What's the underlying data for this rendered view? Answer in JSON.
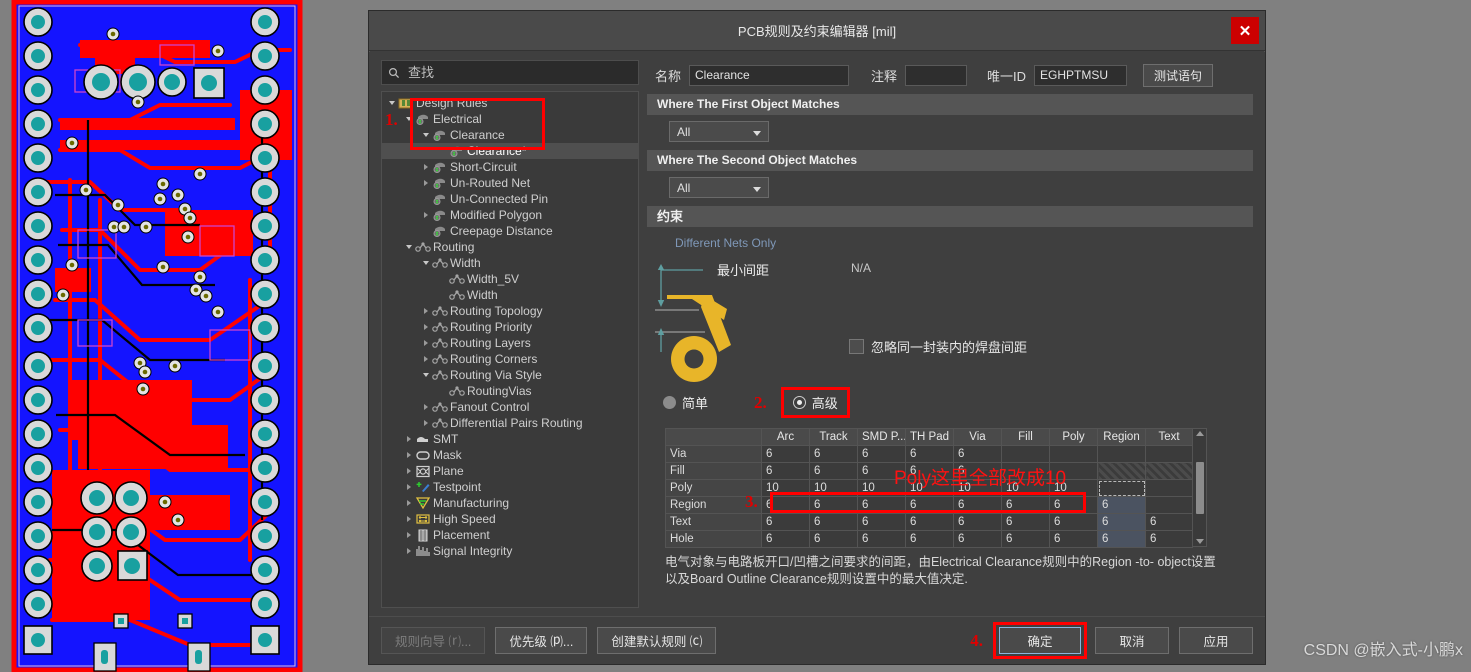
{
  "window": {
    "title": "PCB规则及约束编辑器 [mil]",
    "close_label": "✕"
  },
  "search": {
    "placeholder": "查找",
    "value": "",
    "icon": "search-icon"
  },
  "tree": {
    "items": [
      {
        "label": "Design Rules",
        "depth": 0,
        "arrow": "down",
        "icon": "folder-rules-icon",
        "selected": false
      },
      {
        "label": "Electrical",
        "depth": 1,
        "arrow": "down",
        "icon": "electrical-icon",
        "selected": false
      },
      {
        "label": "Clearance",
        "depth": 2,
        "arrow": "down",
        "icon": "electrical-icon",
        "selected": false
      },
      {
        "label": "Clearance*",
        "depth": 3,
        "arrow": "none",
        "icon": "electrical-icon",
        "selected": true
      },
      {
        "label": "Short-Circuit",
        "depth": 2,
        "arrow": "right",
        "icon": "electrical-icon",
        "selected": false
      },
      {
        "label": "Un-Routed Net",
        "depth": 2,
        "arrow": "right",
        "icon": "electrical-icon",
        "selected": false
      },
      {
        "label": "Un-Connected Pin",
        "depth": 2,
        "arrow": "none",
        "icon": "electrical-icon",
        "selected": false
      },
      {
        "label": "Modified Polygon",
        "depth": 2,
        "arrow": "right",
        "icon": "electrical-icon",
        "selected": false
      },
      {
        "label": "Creepage Distance",
        "depth": 2,
        "arrow": "none",
        "icon": "electrical-icon",
        "selected": false
      },
      {
        "label": "Routing",
        "depth": 1,
        "arrow": "down",
        "icon": "routing-icon",
        "selected": false
      },
      {
        "label": "Width",
        "depth": 2,
        "arrow": "down",
        "icon": "routing-icon",
        "selected": false
      },
      {
        "label": "Width_5V",
        "depth": 3,
        "arrow": "none",
        "icon": "routing-icon",
        "selected": false
      },
      {
        "label": "Width",
        "depth": 3,
        "arrow": "none",
        "icon": "routing-icon",
        "selected": false
      },
      {
        "label": "Routing Topology",
        "depth": 2,
        "arrow": "right",
        "icon": "routing-icon",
        "selected": false
      },
      {
        "label": "Routing Priority",
        "depth": 2,
        "arrow": "right",
        "icon": "routing-icon",
        "selected": false
      },
      {
        "label": "Routing Layers",
        "depth": 2,
        "arrow": "right",
        "icon": "routing-icon",
        "selected": false
      },
      {
        "label": "Routing Corners",
        "depth": 2,
        "arrow": "right",
        "icon": "routing-icon",
        "selected": false
      },
      {
        "label": "Routing Via Style",
        "depth": 2,
        "arrow": "down",
        "icon": "routing-icon",
        "selected": false
      },
      {
        "label": "RoutingVias",
        "depth": 3,
        "arrow": "none",
        "icon": "routing-icon",
        "selected": false
      },
      {
        "label": "Fanout Control",
        "depth": 2,
        "arrow": "right",
        "icon": "routing-icon",
        "selected": false
      },
      {
        "label": "Differential Pairs Routing",
        "depth": 2,
        "arrow": "right",
        "icon": "routing-icon",
        "selected": false
      },
      {
        "label": "SMT",
        "depth": 1,
        "arrow": "right",
        "icon": "smt-icon",
        "selected": false
      },
      {
        "label": "Mask",
        "depth": 1,
        "arrow": "right",
        "icon": "mask-icon",
        "selected": false
      },
      {
        "label": "Plane",
        "depth": 1,
        "arrow": "right",
        "icon": "plane-icon",
        "selected": false
      },
      {
        "label": "Testpoint",
        "depth": 1,
        "arrow": "right",
        "icon": "testpoint-icon",
        "selected": false
      },
      {
        "label": "Manufacturing",
        "depth": 1,
        "arrow": "right",
        "icon": "manufacturing-icon",
        "selected": false
      },
      {
        "label": "High Speed",
        "depth": 1,
        "arrow": "right",
        "icon": "highspeed-icon",
        "selected": false
      },
      {
        "label": "Placement",
        "depth": 1,
        "arrow": "right",
        "icon": "placement-icon",
        "selected": false
      },
      {
        "label": "Signal Integrity",
        "depth": 1,
        "arrow": "right",
        "icon": "signal-integrity-icon",
        "selected": false
      }
    ]
  },
  "form": {
    "name_label": "名称",
    "name_value": "Clearance",
    "comment_label": "注释",
    "comment_value": "",
    "uniqueid_label": "唯一ID",
    "uniqueid_value": "EGHPTMSU",
    "test_button": "测试语句"
  },
  "sections": {
    "first_match_title": "Where The First Object Matches",
    "first_match_value": "All",
    "second_match_title": "Where The Second Object Matches",
    "second_match_value": "All",
    "constraint_title": "约束"
  },
  "constraint": {
    "different_nets_only": "Different Nets Only",
    "min_clearance_label": "最小间距",
    "na_value": "N/A",
    "ignore_checkbox_label": "忽略同一封装内的焊盘间距",
    "ignore_checked": false,
    "mode_simple": "简单",
    "mode_advanced": "高级",
    "mode_selected": "高级"
  },
  "table": {
    "columns": [
      "",
      "Arc",
      "Track",
      "SMD P...",
      "TH Pad",
      "Via",
      "Fill",
      "Poly",
      "Region",
      "Text"
    ],
    "rows": [
      {
        "header": "Via",
        "values": [
          "6",
          "6",
          "6",
          "6",
          "6",
          "",
          "",
          "",
          ""
        ]
      },
      {
        "header": "Fill",
        "values": [
          "6",
          "6",
          "6",
          "6",
          "6",
          "",
          "",
          "",
          ""
        ]
      },
      {
        "header": "Poly",
        "values": [
          "10",
          "10",
          "10",
          "10",
          "10",
          "10",
          "10",
          "",
          ""
        ]
      },
      {
        "header": "Region",
        "values": [
          "6",
          "6",
          "6",
          "6",
          "6",
          "6",
          "6",
          "6",
          ""
        ]
      },
      {
        "header": "Text",
        "values": [
          "6",
          "6",
          "6",
          "6",
          "6",
          "6",
          "6",
          "6",
          "6"
        ]
      },
      {
        "header": "Hole",
        "values": [
          "6",
          "6",
          "6",
          "6",
          "6",
          "6",
          "6",
          "6",
          "6"
        ]
      }
    ]
  },
  "description": "电气对象与电路板开口/凹槽之间要求的间距，由Electrical Clearance规则中的Region -to- object设置以及Board Outline Clearance规则设置中的最大值决定.",
  "buttons": {
    "rule_wizard": "规则向导 ⒭...",
    "priority": "优先级 ⒫...",
    "create_default": "创建默认规则 ⒞",
    "ok": "确定",
    "cancel": "取消",
    "apply": "应用"
  },
  "annotations": {
    "step1": "1.",
    "step2": "2.",
    "step3": "3.",
    "step4": "4.",
    "note_text": "Poly这里全部改成10",
    "highlight_color": "#ff0000"
  },
  "watermark": "CSDN @嵌入式-小鹏x",
  "pcb": {
    "board_bg": "#1414ff",
    "trace_color": "#ff0000",
    "pad_ring": "#d9d9d9",
    "pad_hole": "#18a0a0",
    "outline": "#ff0000"
  }
}
